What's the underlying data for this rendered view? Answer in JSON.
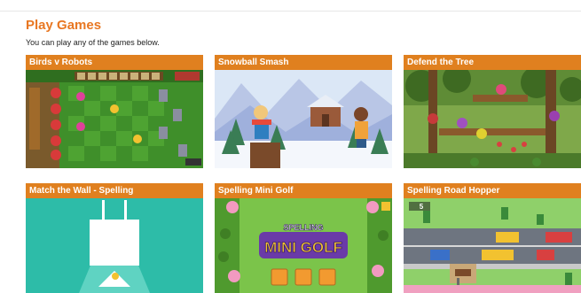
{
  "page": {
    "title": "Play Games",
    "intro": "You can play any of the games below."
  },
  "games": [
    {
      "title": "Birds v Robots",
      "thumbnail": "birds-v-robots-thumbnail"
    },
    {
      "title": "Snowball Smash",
      "thumbnail": "snowball-smash-thumbnail"
    },
    {
      "title": "Defend the Tree",
      "thumbnail": "defend-the-tree-thumbnail"
    },
    {
      "title": "Match the Wall - Spelling",
      "thumbnail": "match-the-wall-thumbnail"
    },
    {
      "title": "Spelling Mini Golf",
      "thumbnail": "spelling-mini-golf-thumbnail",
      "logo_top": "SPELLING",
      "logo_bottom": "MINI GOLF"
    },
    {
      "title": "Spelling Road Hopper",
      "thumbnail": "spelling-road-hopper-thumbnail",
      "hud_count": "5"
    }
  ],
  "colors": {
    "accent": "#e87722",
    "label_bar": "#e0801f"
  }
}
